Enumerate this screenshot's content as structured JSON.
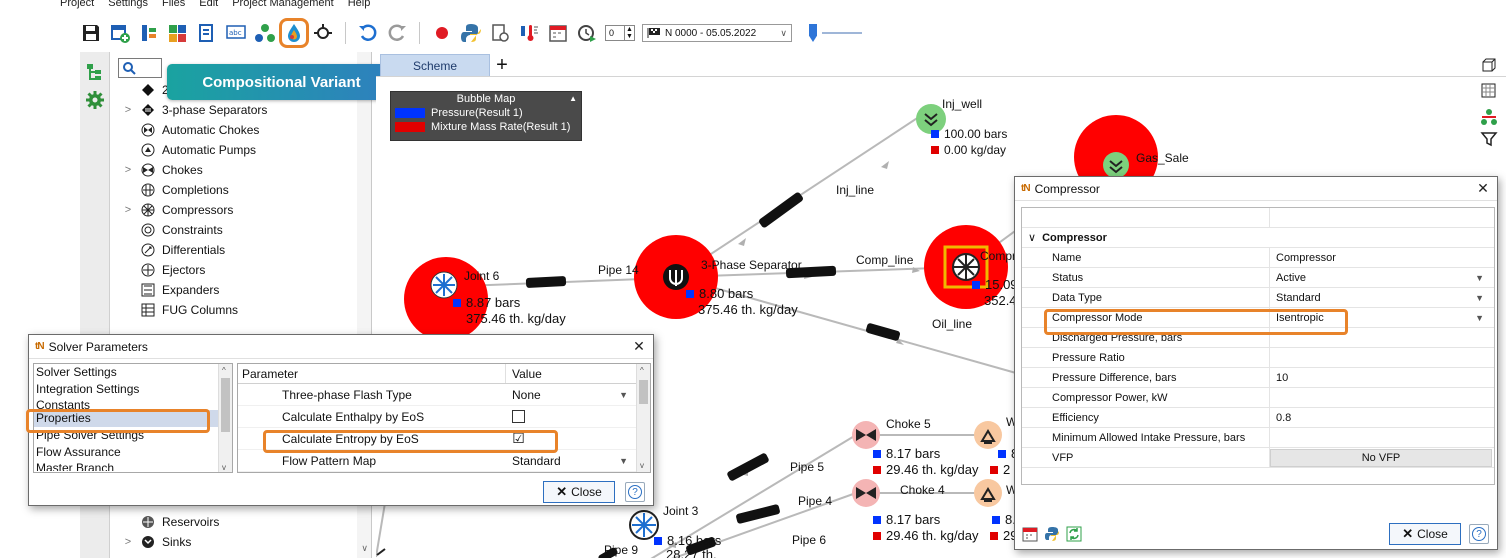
{
  "menu": [
    "Project",
    "Settings",
    "Files",
    "Edit",
    "Project Management",
    "Help"
  ],
  "toolbar": {
    "spin_value": "0",
    "branch_label": "N 0000 - 05.05.2022"
  },
  "callout": "Compositional Variant",
  "tree": {
    "items": [
      {
        "label": "2",
        "chevron": ""
      },
      {
        "label": "3-phase Separators",
        "chevron": ">"
      },
      {
        "label": "Automatic Chokes",
        "chevron": ""
      },
      {
        "label": "Automatic Pumps",
        "chevron": ""
      },
      {
        "label": "Chokes",
        "chevron": ">"
      },
      {
        "label": "Completions",
        "chevron": ""
      },
      {
        "label": "Compressors",
        "chevron": ">"
      },
      {
        "label": "Constraints",
        "chevron": ""
      },
      {
        "label": "Differentials",
        "chevron": ""
      },
      {
        "label": "Ejectors",
        "chevron": ""
      },
      {
        "label": "Expanders",
        "chevron": ""
      },
      {
        "label": "FUG Columns",
        "chevron": ""
      }
    ],
    "bottom_items": [
      {
        "label": "Reservoirs",
        "chevron": ""
      },
      {
        "label": "Sinks",
        "chevron": ">"
      }
    ]
  },
  "canvas": {
    "tab": "Scheme",
    "legend": {
      "title": "Bubble Map",
      "rows": [
        {
          "label": "Pressure(Result 1)",
          "color": "#0033ff"
        },
        {
          "label": "Mixture Mass Rate(Result 1)",
          "color": "#e00000"
        }
      ]
    },
    "labels": {
      "inj_well": "Inj_well",
      "inj_well_p": "100.00 bars",
      "inj_well_r": "0.00 kg/day",
      "gas_sale": "Gas_Sale",
      "inj_line": "Inj_line",
      "joint6": "Joint 6",
      "joint6_p": "8.87 bars",
      "joint6_r": "375.46 th. kg/day",
      "pipe14": "Pipe 14",
      "sep": "3-Phase Separator",
      "sep_p": "8.80 bars",
      "sep_r": "375.46 th. kg/day",
      "comp_line": "Comp_line",
      "comp": "Compr",
      "comp_p": "15.09",
      "comp_r": "352.44",
      "oil_line": "Oil_line",
      "choke5": "Choke 5",
      "choke5_p": "8.17 bars",
      "choke5_r": "29.46 th. kg/day",
      "w1": "W",
      "w1_p": "8",
      "w1_r": "2",
      "pipe5": "Pipe 5",
      "pipe4": "Pipe 4",
      "choke4": "Choke 4",
      "choke4_p": "8.17 bars",
      "choke4_r": "29.46 th. kg/day",
      "w2": "W",
      "w2_p": "8.",
      "w2_r": "29",
      "joint3": "Joint 3",
      "joint3_p": "8.16 bars",
      "joint3_r": "28.27 th.",
      "pipe6": "Pipe 6",
      "pipe9": "Pipe 9"
    }
  },
  "solver": {
    "title": "Solver Parameters",
    "categories": [
      "Solver Settings",
      "Integration Settings",
      "Constants",
      "Properties",
      "Pipe Solver Settings",
      "Flow Assurance",
      "Master Branch"
    ],
    "selected": "Properties",
    "col_param": "Parameter",
    "col_value": "Value",
    "rows": [
      {
        "param": "Three-phase Flash Type",
        "value": "None",
        "kind": "dropdown"
      },
      {
        "param": "Calculate Enthalpy by EoS",
        "value": "",
        "kind": "checkbox"
      },
      {
        "param": "Calculate Entropy by EoS",
        "value": "☑",
        "kind": "checkbox"
      },
      {
        "param": "Flow Pattern Map",
        "value": "Standard",
        "kind": "dropdown"
      }
    ],
    "close": "Close",
    "help": "?"
  },
  "compressor": {
    "title": "Compressor",
    "group": "Compressor",
    "rows": [
      {
        "key": "Name",
        "value": "Compressor",
        "dropdown": false
      },
      {
        "key": "Status",
        "value": "Active",
        "dropdown": true
      },
      {
        "key": "Data Type",
        "value": "Standard",
        "dropdown": true
      },
      {
        "key": "Compressor Mode",
        "value": "Isentropic",
        "dropdown": true
      },
      {
        "key": "Discharged Pressure, bars",
        "value": "",
        "dropdown": false
      },
      {
        "key": "Pressure Ratio",
        "value": "",
        "dropdown": false
      },
      {
        "key": "Pressure Difference, bars",
        "value": "10",
        "dropdown": false
      },
      {
        "key": "Compressor Power, kW",
        "value": "",
        "dropdown": false
      },
      {
        "key": "Efficiency",
        "value": "0.8",
        "dropdown": false
      },
      {
        "key": "Minimum Allowed Intake Pressure, bars",
        "value": "",
        "dropdown": false
      }
    ],
    "vfp_key": "VFP",
    "vfp_value": "No VFP",
    "close": "Close",
    "help": "?"
  },
  "colors": {
    "highlight": "#e8832a",
    "bubble": "#ff0000",
    "accent": "#2d6fc0"
  }
}
